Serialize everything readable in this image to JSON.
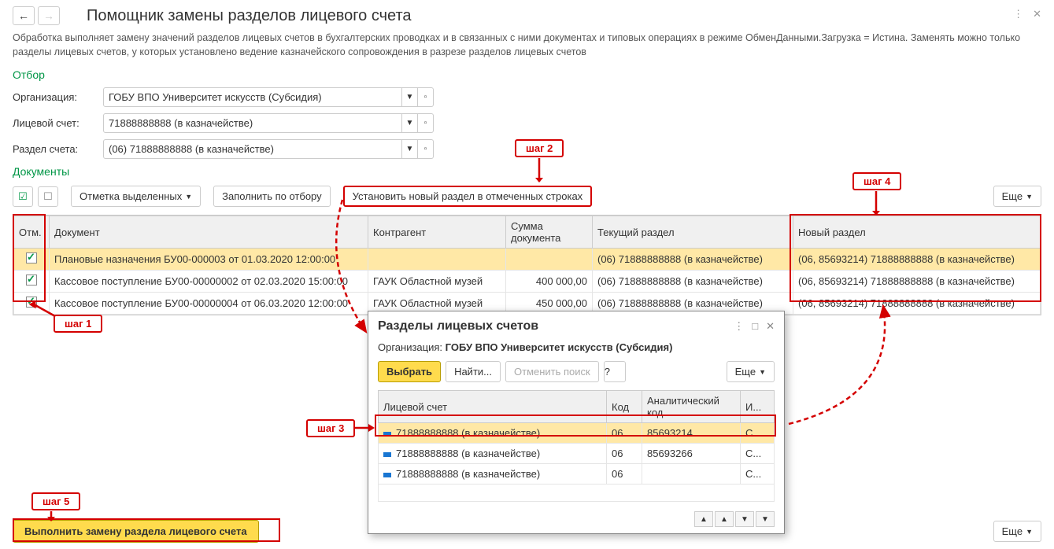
{
  "header": {
    "title": "Помощник замены разделов лицевого счета",
    "description": "Обработка выполняет замену значений разделов лицевых счетов в бухгалтерских проводках и в связанных с ними документах и типовых операциях в режиме ОбменДанными.Загрузка = Истина. Заменять можно только разделы лицевых счетов, у которых установлено ведение казначейского сопровождения в разрезе разделов лицевых счетов"
  },
  "filter": {
    "section_title": "Отбор",
    "org_label": "Организация:",
    "org_value": "ГОБУ ВПО Университет искусств (Субсидия)",
    "account_label": "Лицевой счет:",
    "account_value": "71888888888 (в казначействе)",
    "section_label": "Раздел счета:",
    "section_value": "(06) 71888888888 (в казначействе)"
  },
  "docs": {
    "section_title": "Документы",
    "mark_btn": "Отметка выделенных",
    "fill_btn": "Заполнить по отбору",
    "set_btn": "Установить новый раздел в отмеченных строках",
    "more_btn": "Еще",
    "columns": {
      "mark": "Отм.",
      "doc": "Документ",
      "contr": "Контрагент",
      "sum": "Сумма документа",
      "cur": "Текущий раздел",
      "new": "Новый раздел"
    },
    "rows": [
      {
        "doc": "Плановые назначения БУ00-000003 от 01.03.2020 12:00:00",
        "contr": "",
        "sum": "",
        "cur": "(06) 71888888888 (в казначействе)",
        "new": "(06, 85693214) 71888888888 (в казначействе)"
      },
      {
        "doc": "Кассовое поступление БУ00-00000002 от 02.03.2020 15:00:00",
        "contr": "ГАУК Областной музей",
        "sum": "400 000,00",
        "cur": "(06) 71888888888 (в казначействе)",
        "new": "(06, 85693214) 71888888888 (в казначействе)"
      },
      {
        "doc": "Кассовое поступление БУ00-00000004 от 06.03.2020 12:00:00",
        "contr": "ГАУК Областной музей",
        "sum": "450 000,00",
        "cur": "(06) 71888888888 (в казначействе)",
        "new": "(06, 85693214) 71888888888 (в казначействе)"
      }
    ]
  },
  "popup": {
    "title": "Разделы лицевых счетов",
    "org_label": "Организация:",
    "org_value": "ГОБУ ВПО Университет искусств (Субсидия)",
    "select_btn": "Выбрать",
    "find_btn": "Найти...",
    "cancel_btn": "Отменить поиск",
    "help_btn": "?",
    "more_btn": "Еще",
    "columns": {
      "account": "Лицевой счет",
      "code": "Код",
      "acode": "Аналитический код",
      "iff": "И..."
    },
    "rows": [
      {
        "account": "71888888888 (в казначействе)",
        "code": "06",
        "acode": "85693214",
        "iff": "С..."
      },
      {
        "account": "71888888888 (в казначействе)",
        "code": "06",
        "acode": "85693266",
        "iff": "С..."
      },
      {
        "account": "71888888888 (в казначействе)",
        "code": "06",
        "acode": "",
        "iff": "С..."
      }
    ]
  },
  "bottom": {
    "execute_btn": "Выполнить замену раздела лицевого счета",
    "more_btn": "Еще"
  },
  "callouts": {
    "step1": "шаг 1",
    "step2": "шаг 2",
    "step3": "шаг 3",
    "step4": "шаг 4",
    "step5": "шаг 5"
  }
}
